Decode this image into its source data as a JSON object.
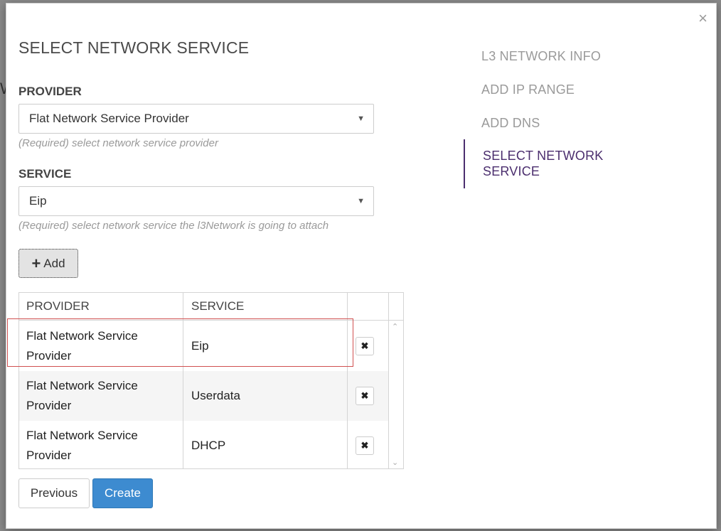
{
  "backdrop": {
    "fragment": "W"
  },
  "dialog": {
    "title": "SELECT NETWORK SERVICE",
    "close_symbol": "×"
  },
  "form": {
    "provider": {
      "label": "PROVIDER",
      "value": "Flat Network Service Provider",
      "help": "(Required) select network service provider"
    },
    "service": {
      "label": "SERVICE",
      "value": "Eip",
      "help": "(Required) select network service the l3Network is going to attach"
    },
    "add_label": "Add"
  },
  "table": {
    "columns": [
      "PROVIDER",
      "SERVICE"
    ],
    "rows": [
      {
        "provider_line1": "Flat Network Service",
        "provider_line2": "Provider",
        "service": "Eip"
      },
      {
        "provider_line1": "Flat Network Service",
        "provider_line2": "Provider",
        "service": "Userdata"
      },
      {
        "provider_line1": "Flat Network Service",
        "provider_line2": "Provider",
        "service": "DHCP"
      }
    ],
    "delete_symbol": "✖"
  },
  "footer": {
    "previous_label": "Previous",
    "create_label": "Create"
  },
  "steps": [
    {
      "label": "L3 NETWORK INFO"
    },
    {
      "label": "ADD IP RANGE"
    },
    {
      "label": "ADD DNS"
    },
    {
      "label_line1": "SELECT NETWORK",
      "label_line2": "SERVICE",
      "active": true
    }
  ],
  "colors": {
    "accent": "#4b2e6e",
    "primary_button": "#3d8bd0",
    "highlight_border": "#d05050"
  }
}
